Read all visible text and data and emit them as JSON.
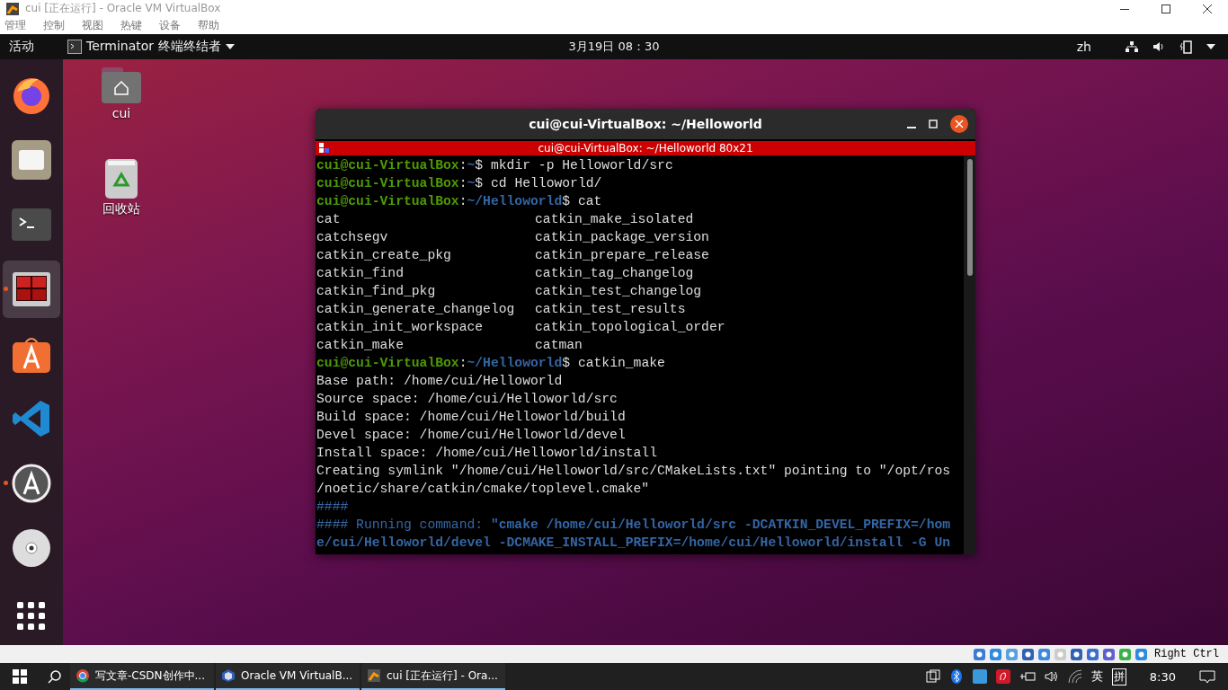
{
  "window": {
    "title": "cui [正在运行] - Oracle VM VirtualBox"
  },
  "menu": [
    "管理",
    "控制",
    "视图",
    "热键",
    "设备",
    "帮助"
  ],
  "top_bar": {
    "activities": "活动",
    "app_menu": "Terminator 终端终结者",
    "clock": "3月19日  08：30",
    "input_method": "zh"
  },
  "dock": [
    {
      "kind": "firefox",
      "running": false,
      "selected": false
    },
    {
      "kind": "files",
      "running": false,
      "selected": false
    },
    {
      "kind": "terminal",
      "running": false,
      "selected": false
    },
    {
      "kind": "terminator",
      "running": true,
      "selected": true
    },
    {
      "kind": "store",
      "running": false,
      "selected": false
    },
    {
      "kind": "vscode",
      "running": false,
      "selected": false
    },
    {
      "kind": "updater",
      "running": true,
      "selected": false
    },
    {
      "kind": "disc",
      "running": false,
      "selected": false
    }
  ],
  "desktop_icons": [
    {
      "kind": "home",
      "label": "cui"
    },
    {
      "kind": "trash",
      "label": "回收站"
    }
  ],
  "terminal": {
    "title": "cui@cui-VirtualBox: ~/Helloworld",
    "tab_title": "cui@cui-VirtualBox: ~/Helloworld 80x21",
    "lines": [
      {
        "kind": "prompt",
        "user": "cui@cui-VirtualBox",
        "sep": ":",
        "path": "~",
        "sym": "$",
        "command": "mkdir -p Helloworld/src"
      },
      {
        "kind": "prompt",
        "user": "cui@cui-VirtualBox",
        "sep": ":",
        "path": "~",
        "sym": "$",
        "command": "cd Helloworld/"
      },
      {
        "kind": "prompt",
        "user": "cui@cui-VirtualBox",
        "sep": ":",
        "path": "~/Helloworld",
        "sym": "$",
        "command": "cat"
      },
      {
        "kind": "columns",
        "left": "cat",
        "right": "catkin_make_isolated"
      },
      {
        "kind": "columns",
        "left": "catchsegv",
        "right": "catkin_package_version"
      },
      {
        "kind": "columns",
        "left": "catkin_create_pkg",
        "right": "catkin_prepare_release"
      },
      {
        "kind": "columns",
        "left": "catkin_find",
        "right": "catkin_tag_changelog"
      },
      {
        "kind": "columns",
        "left": "catkin_find_pkg",
        "right": "catkin_test_changelog"
      },
      {
        "kind": "columns",
        "left": "catkin_generate_changelog",
        "right": "catkin_test_results"
      },
      {
        "kind": "columns",
        "left": "catkin_init_workspace",
        "right": "catkin_topological_order"
      },
      {
        "kind": "columns",
        "left": "catkin_make",
        "right": "catman"
      },
      {
        "kind": "prompt",
        "user": "cui@cui-VirtualBox",
        "sep": ":",
        "path": "~/Helloworld",
        "sym": "$",
        "command": "catkin_make"
      },
      {
        "kind": "output",
        "text": "Base path: /home/cui/Helloworld"
      },
      {
        "kind": "output",
        "text": "Source space: /home/cui/Helloworld/src"
      },
      {
        "kind": "output",
        "text": "Build space: /home/cui/Helloworld/build"
      },
      {
        "kind": "output",
        "text": "Devel space: /home/cui/Helloworld/devel"
      },
      {
        "kind": "output",
        "text": "Install space: /home/cui/Helloworld/install"
      },
      {
        "kind": "output",
        "text": "Creating symlink \"/home/cui/Helloworld/src/CMakeLists.txt\" pointing to \"/opt/ros"
      },
      {
        "kind": "output",
        "text": "/noetic/share/catkin/cmake/toplevel.cmake\""
      },
      {
        "kind": "info",
        "text": "####"
      },
      {
        "kind": "info",
        "text": "#### Running command: **\"cmake /home/cui/Helloworld/src -DCATKIN_DEVEL_PREFIX=/hom**"
      },
      {
        "kind": "info",
        "text": "**e/cui/Helloworld/devel -DCMAKE_INSTALL_PREFIX=/home/cui/Helloworld/install -G Un**"
      }
    ]
  },
  "vbox_status": {
    "host_key": "Right Ctrl"
  },
  "taskbar": {
    "items": [
      {
        "kind": "chrome",
        "label": "写文章-CSDN创作中..."
      },
      {
        "kind": "virtualbox",
        "label": "Oracle VM VirtualB..."
      },
      {
        "kind": "vm",
        "label": "cui [正在运行] - Ora..."
      }
    ],
    "lang": "英",
    "ime": "拼",
    "time": "8:30"
  }
}
